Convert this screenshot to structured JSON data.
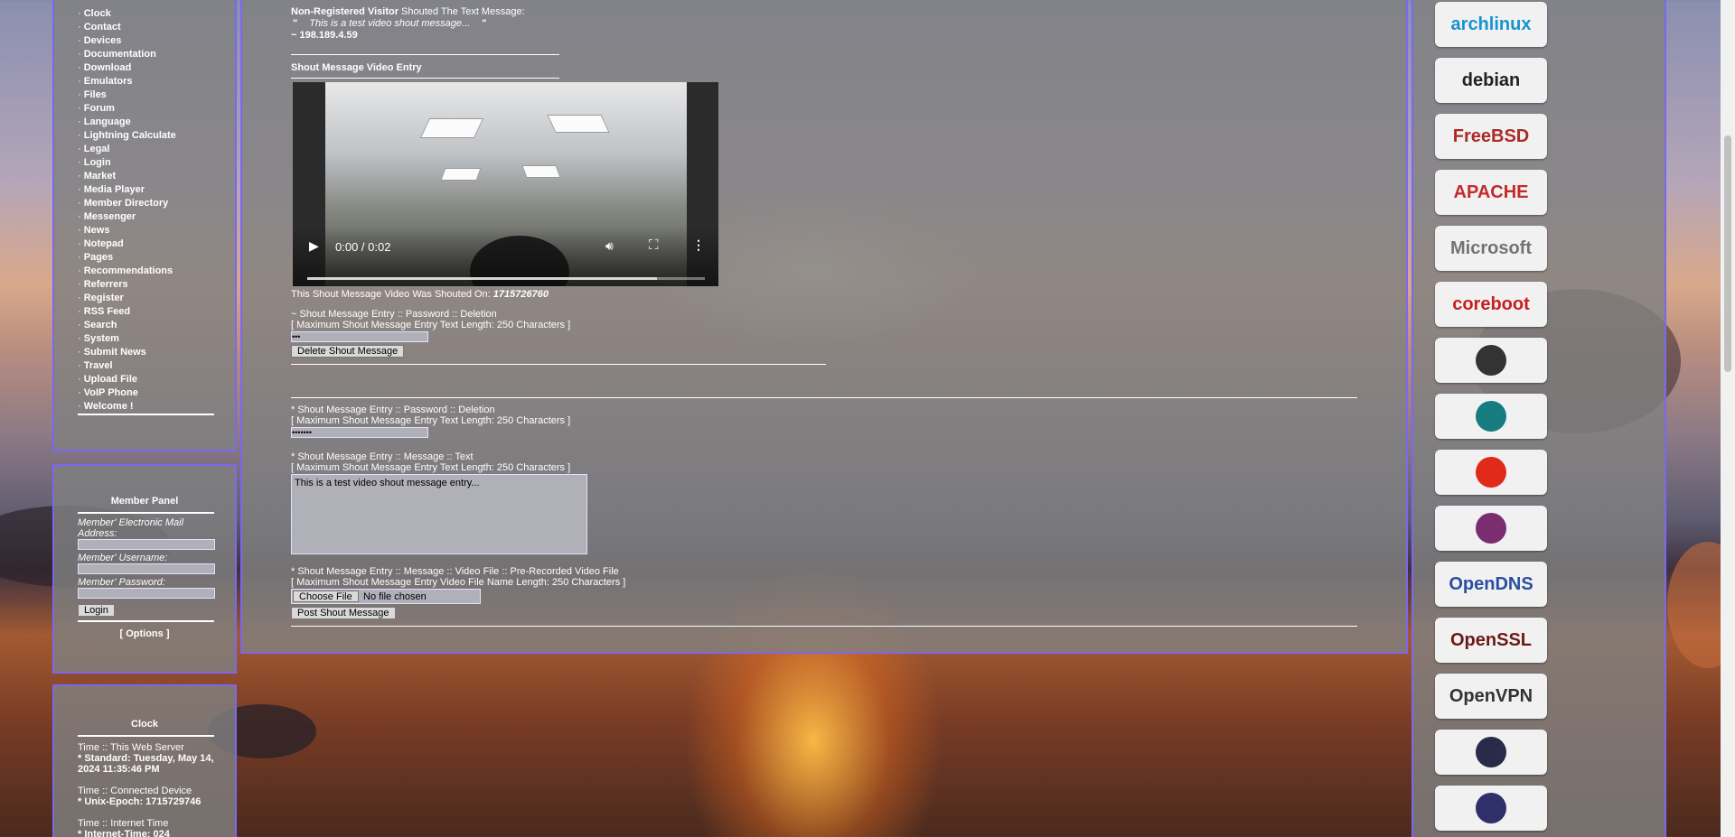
{
  "nav": {
    "items": [
      "Clock",
      "Contact",
      "Devices",
      "Documentation",
      "Download",
      "Emulators",
      "Files",
      "Forum",
      "Language",
      "Lightning Calculate",
      "Legal",
      "Login",
      "Market",
      "Media Player",
      "Member Directory",
      "Messenger",
      "News",
      "Notepad",
      "Pages",
      "Recommendations",
      "Referrers",
      "Register",
      "RSS Feed",
      "Search",
      "System",
      "Submit News",
      "Travel",
      "Upload File",
      "VoIP Phone",
      "Welcome !"
    ]
  },
  "member_panel": {
    "title": "Member Panel",
    "email_label": "Member' Electronic Mail Address:",
    "username_label": "Member' Username:",
    "password_label": "Member' Password:",
    "login_button": "Login",
    "options_link": "[ Options ]"
  },
  "clock_panel": {
    "title": "Clock",
    "server_heading": "Time :: This Web Server",
    "server_standard": "* Standard: Tuesday, May 14, 2024 11:35:46 PM",
    "device_heading": "Time :: Connected Device",
    "device_epoch": "* Unix-Epoch: 1715729746",
    "internet_heading": "Time :: Internet Time",
    "internet_time": "* Internet-Time: 024"
  },
  "shout": {
    "visitor_label": "Non-Registered Visitor",
    "shouted_text": " Shouted The Text Message:",
    "quote_open": "\"",
    "message": "This is a test video shout message...",
    "quote_close": "\"",
    "ip": "~ 198.189.4.59",
    "video_heading": "Shout Message Video Entry",
    "video_time": "0:00 / 0:02",
    "video_progress": 0.88,
    "shouted_on_label": "This Shout Message Video Was Shouted On: ",
    "shouted_on_value": "1715726760",
    "delete_heading": "~ Shout Message Entry :: Password :: Deletion",
    "delete_max": "[ Maximum Shout Message Entry Text Length: 250 Characters ]",
    "delete_password_value": "•••",
    "delete_button": "Delete Shout Message"
  },
  "form": {
    "password_heading": "* Shout Message Entry :: Password :: Deletion",
    "password_max": "[ Maximum Shout Message Entry Text Length: 250 Characters ]",
    "password_value": "•••••••",
    "text_heading": "* Shout Message Entry :: Message :: Text",
    "text_max": "[ Maximum Shout Message Entry Text Length: 250 Characters ]",
    "text_value": "This is a test video shout message entry...",
    "video_heading": "* Shout Message Entry :: Message :: Video File :: Pre-Recorded Video File",
    "video_max": "[ Maximum Shout Message Entry Video File Name Length: 250 Characters ]",
    "choose_file_button": "Choose File",
    "no_file_text": "No file chosen",
    "post_button": "Post Shout Message"
  },
  "sidebar_logos": [
    {
      "name": "archlinux",
      "text": "archlinux",
      "color": "#1793d1"
    },
    {
      "name": "debian",
      "text": "debian",
      "color": "#222222"
    },
    {
      "name": "freebsd",
      "text": "FreeBSD",
      "color": "#ab2b28"
    },
    {
      "name": "apache",
      "text": "APACHE",
      "color": "#c22b2b"
    },
    {
      "name": "microsoft",
      "text": "Microsoft",
      "color": "#737373"
    },
    {
      "name": "coreboot",
      "text": "coreboot",
      "color": "#c71e1e"
    },
    {
      "name": "terminal",
      "text": "",
      "color": "#333333"
    },
    {
      "name": "lineageos",
      "text": "",
      "color": "#167c80"
    },
    {
      "name": "tomato",
      "text": "",
      "color": "#e02a1a"
    },
    {
      "name": "lotus",
      "text": "",
      "color": "#7a2d6f"
    },
    {
      "name": "opendns",
      "text": "OpenDNS",
      "color": "#2a4fa0"
    },
    {
      "name": "openssl",
      "text": "OpenSSL",
      "color": "#6b1a1a"
    },
    {
      "name": "openvpn",
      "text": "OpenVPN",
      "color": "#333333"
    },
    {
      "name": "keys",
      "text": "",
      "color": "#2a2a4a"
    },
    {
      "name": "keepass",
      "text": "",
      "color": "#2f2f6a"
    }
  ]
}
